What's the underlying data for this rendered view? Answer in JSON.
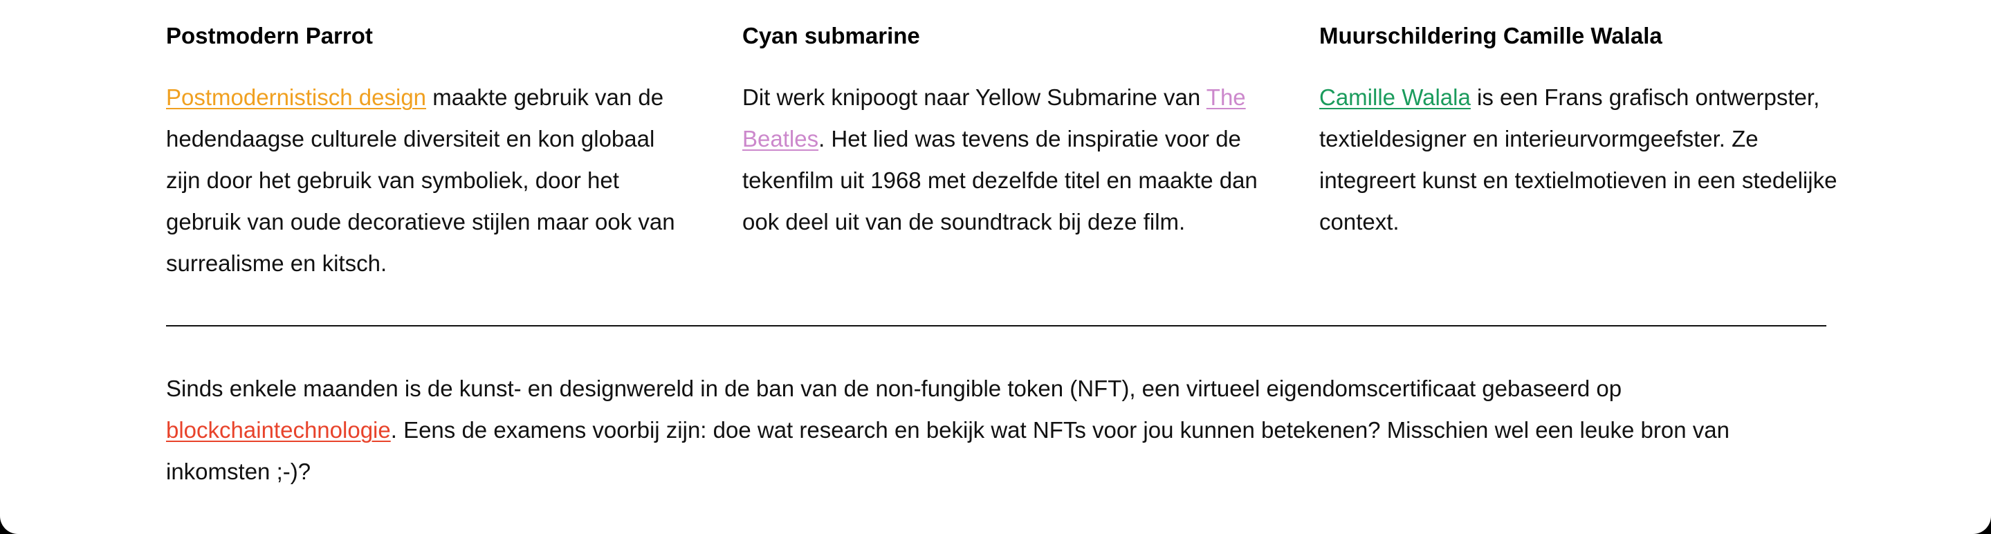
{
  "columns": [
    {
      "title": "Postmodern Parrot",
      "link_text": "Postmodernistisch design",
      "body_after_link": " maakte gebruik van de hedendaagse culturele diversiteit en kon globaal zijn door het gebruik van symboliek, door het gebruik van oude decoratieve stijlen maar ook van surrealisme en kitsch.",
      "link_color": "#f0a020"
    },
    {
      "title": "Cyan submarine",
      "body_before_link": "Dit werk knipoogt naar Yellow Submarine van ",
      "link_text": "The Beatles",
      "body_after_link": ". Het lied was tevens de inspiratie voor de tekenfilm uit 1968 met dezelfde titel en maakte dan ook deel uit van de soundtrack bij deze film.",
      "link_color": "#cc88cc"
    },
    {
      "title": "Muurschildering Camille Walala",
      "link_text": "Camille Walala",
      "body_after_link": " is een Frans grafisch ontwerpster, textieldesigner en interieurvormgeefster. Ze integreert kunst en textielmotieven in een stedelijke context.",
      "link_color": "#1a9b5c"
    }
  ],
  "footer": {
    "body_before_link": "Sinds enkele maanden is de kunst- en designwereld in de ban van de non-fungible token (NFT), een virtueel eigendomscertificaat gebaseerd op ",
    "link_text": "blockchaintechnologie",
    "body_after_link": ". Eens de examens voorbij zijn: doe wat research en bekijk wat NFTs voor jou kunnen betekenen? Misschien wel een leuke bron van inkomsten ;-)?",
    "link_color": "#e8432b"
  }
}
